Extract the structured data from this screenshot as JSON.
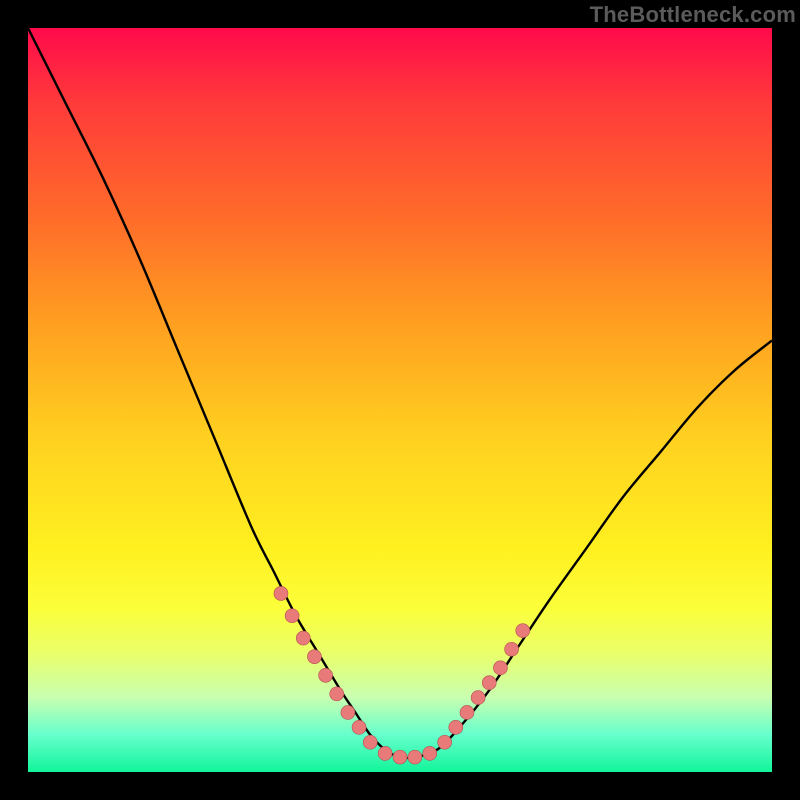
{
  "watermark": "TheBottleneck.com",
  "chart_data": {
    "type": "line",
    "title": "",
    "xlabel": "",
    "ylabel": "",
    "xlim": [
      0,
      100
    ],
    "ylim": [
      0,
      100
    ],
    "curve": {
      "x": [
        0,
        5,
        10,
        15,
        20,
        25,
        30,
        33,
        36,
        39,
        42,
        44,
        46,
        48,
        50,
        52,
        55,
        58,
        62,
        66,
        70,
        75,
        80,
        85,
        90,
        95,
        100
      ],
      "y": [
        100,
        90,
        80,
        69,
        57,
        45,
        33,
        27,
        21,
        16,
        11,
        8,
        5,
        3,
        2,
        2,
        3,
        6,
        11,
        17,
        23,
        30,
        37,
        43,
        49,
        54,
        58
      ]
    },
    "dots_left": {
      "x": [
        34.0,
        35.5,
        37.0,
        38.5,
        40.0,
        41.5,
        43.0,
        44.5,
        46.0
      ],
      "y": [
        24.0,
        21.0,
        18.0,
        15.5,
        13.0,
        10.5,
        8.0,
        6.0,
        4.0
      ]
    },
    "dots_bottom": {
      "x": [
        48.0,
        50.0,
        52.0,
        54.0
      ],
      "y": [
        2.5,
        2.0,
        2.0,
        2.5
      ]
    },
    "dots_right": {
      "x": [
        56.0,
        57.5,
        59.0,
        60.5,
        62.0,
        63.5,
        65.0,
        66.5
      ],
      "y": [
        4.0,
        6.0,
        8.0,
        10.0,
        12.0,
        14.0,
        16.5,
        19.0
      ]
    }
  }
}
